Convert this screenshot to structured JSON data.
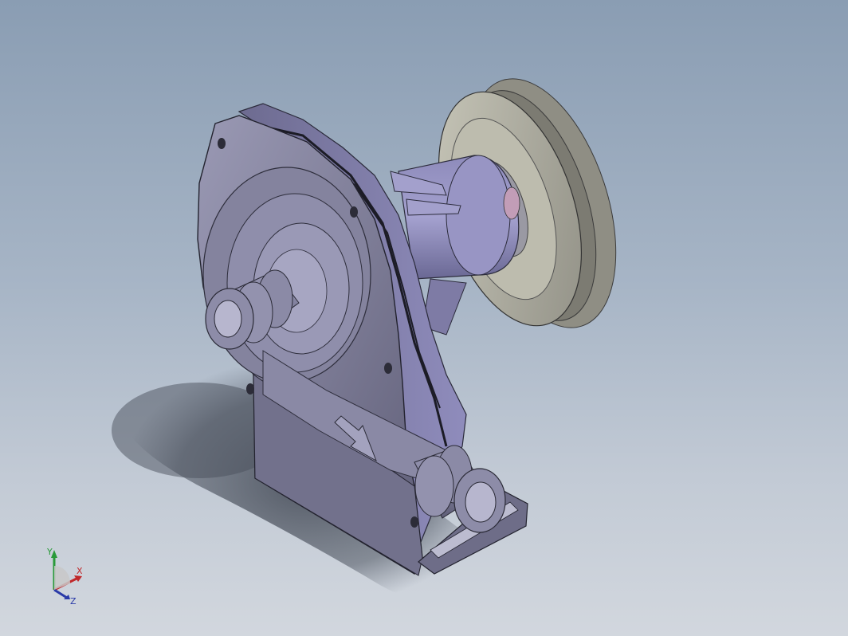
{
  "view": {
    "background_top": "#8a9db3",
    "background_bottom": "#d2d7de"
  },
  "model": {
    "body_color": "#7d7c92",
    "body_highlight": "#a9a8c4",
    "shaft_color": "#8b88b0",
    "pulley_color": "#b4b3a6",
    "shadow_color": "#4c535f"
  },
  "triad": {
    "x_label": "X",
    "y_label": "Y",
    "z_label": "Z",
    "x_color": "#c0282a",
    "y_color": "#2a9a3a",
    "z_color": "#2a3aa8"
  }
}
